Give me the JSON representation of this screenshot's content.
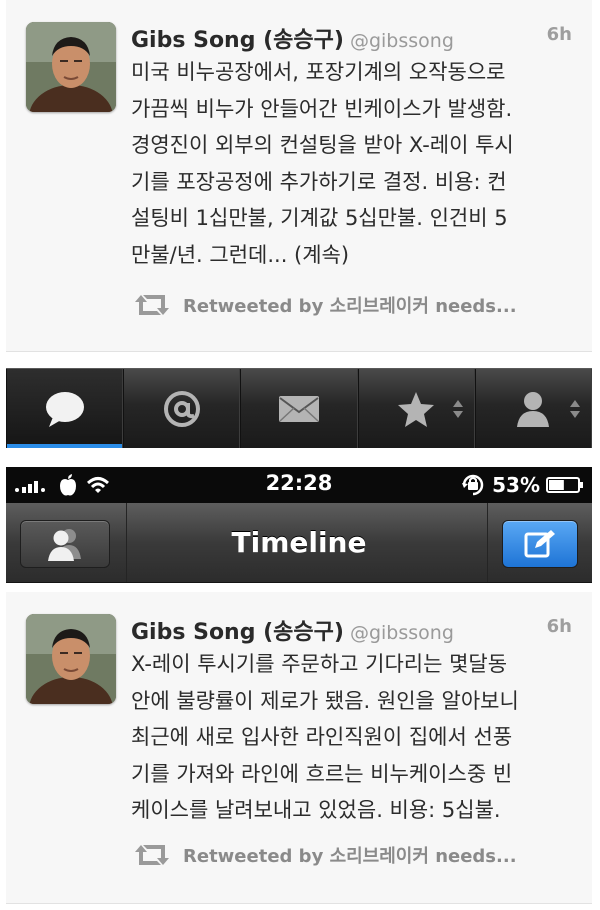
{
  "tweets": [
    {
      "author": "Gibs Song (송승구)",
      "handle": "@gibssong",
      "time": "6h",
      "lines": [
        "미국 비누공장에서, 포장기계의 오작동으로",
        "가끔씩 비누가 안들어간 빈케이스가 발생함.",
        "경영진이 외부의 컨설팅을 받아 X-레이 투시",
        "기를 포장공정에 추가하기로 결정. 비용: 컨",
        "설팅비 1십만불, 기계값 5십만불. 인건비 5",
        "만불/년. 그런데... (계속)"
      ],
      "retweet": "Retweeted by 소리브레이커 needs..."
    },
    {
      "author": "Gibs Song (송승구)",
      "handle": "@gibssong",
      "time": "6h",
      "lines": [
        "X-레이 투시기를 주문하고 기다리는 몇달동",
        "안에 불량률이 제로가 됐음. 원인을 알아보니",
        "최근에 새로 입사한 라인직원이 집에서 선풍",
        "기를 가져와 라인에 흐르는 비누케이스중 빈",
        "케이스를 날려보내고 있었음.  비용: 5십불."
      ],
      "retweet": "Retweeted by 소리브레이커 needs..."
    }
  ],
  "tabbar": {
    "tabs": [
      "speech-bubble-icon",
      "at-sign-icon",
      "envelope-icon",
      "star-icon",
      "person-icon"
    ],
    "active_index": 0,
    "active_color": "#2b8de8"
  },
  "statusbar": {
    "time": "22:28",
    "battery_percent": "53%",
    "battery_level": 0.53
  },
  "navbar": {
    "title": "Timeline"
  },
  "colors": {
    "compose_button": "#2f8ff0",
    "card_background": "#f7f7f7"
  }
}
